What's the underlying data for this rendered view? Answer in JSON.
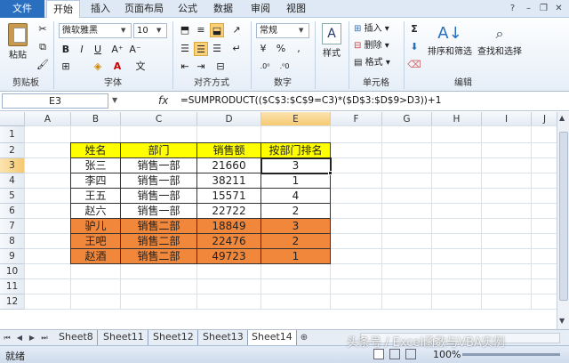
{
  "tabs": [
    "文件",
    "开始",
    "插入",
    "页面布局",
    "公式",
    "数据",
    "审阅",
    "视图"
  ],
  "ribbon": {
    "clipboard": {
      "paste": "粘贴",
      "label": "剪贴板"
    },
    "font": {
      "name": "微软雅黑",
      "size": "10",
      "label": "字体"
    },
    "alignment": {
      "label": "对齐方式"
    },
    "number": {
      "format": "常规",
      "label": "数字"
    },
    "styles": {
      "styles_btn": "样式"
    },
    "cells": {
      "insert": "插入",
      "delete": "删除",
      "format": "格式",
      "label": "单元格"
    },
    "editing": {
      "sort_filter": "排序和筛选",
      "find_select": "查找和选择",
      "label": "编辑"
    }
  },
  "formula_bar": {
    "name_box": "E3",
    "fx": "fx",
    "formula": "=SUMPRODUCT(($C$3:$C$9=C3)*($D$3:$D$9>D3))+1"
  },
  "columns": [
    "A",
    "B",
    "C",
    "D",
    "E",
    "F",
    "G",
    "H",
    "I",
    "J"
  ],
  "rows": [
    "1",
    "2",
    "3",
    "4",
    "5",
    "6",
    "7",
    "8",
    "9",
    "10",
    "11",
    "12"
  ],
  "table": {
    "headers": [
      "姓名",
      "部门",
      "销售额",
      "按部门排名"
    ],
    "rows": [
      [
        "张三",
        "销售一部",
        "21660",
        "3"
      ],
      [
        "李四",
        "销售一部",
        "38211",
        "1"
      ],
      [
        "王五",
        "销售一部",
        "15571",
        "4"
      ],
      [
        "赵六",
        "销售一部",
        "22722",
        "2"
      ],
      [
        "驴儿",
        "销售二部",
        "18849",
        "3"
      ],
      [
        "王吧",
        "销售二部",
        "22476",
        "2"
      ],
      [
        "赵酒",
        "销售二部",
        "49723",
        "1"
      ]
    ]
  },
  "sheet_tabs": [
    "Sheet8",
    "Sheet11",
    "Sheet12",
    "Sheet13",
    "Sheet14"
  ],
  "active_sheet": "Sheet14",
  "status": {
    "ready": "就绪",
    "zoom": "100%"
  },
  "watermark": "头条号 / Excel函数与VBA实例",
  "colors": {
    "header_fill": "#ffff00",
    "group_fill": "#f0873a",
    "accent": "#2a6fbf"
  }
}
